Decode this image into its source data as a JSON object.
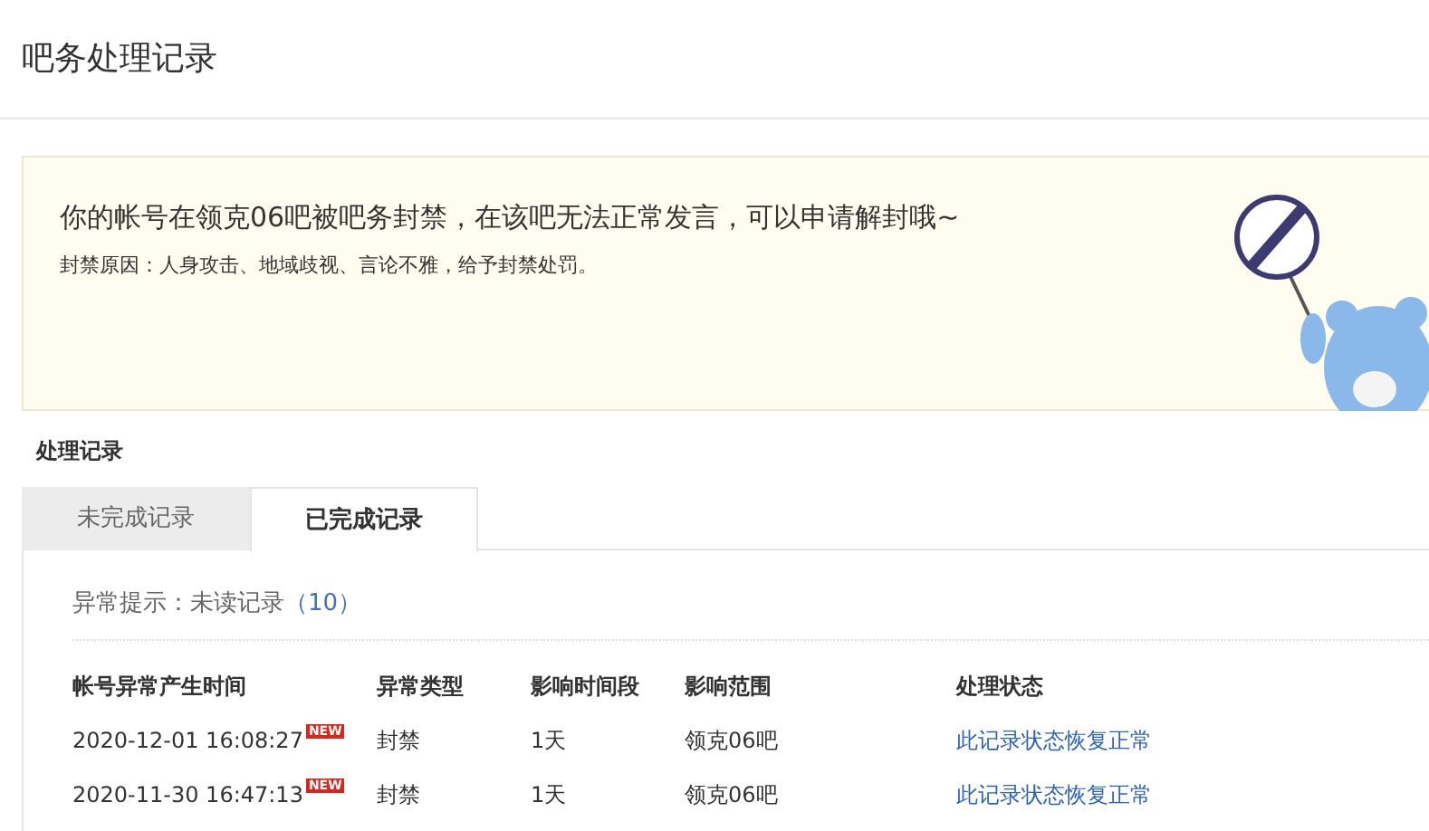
{
  "page_title": "吧务处理记录",
  "notice": {
    "message": "你的帐号在领克06吧被吧务封禁，在该吧无法正常发言，可以申请解封哦~",
    "reason": "封禁原因：人身攻击、地域歧视、言论不雅，给予封禁处罚。"
  },
  "section_title": "处理记录",
  "tabs": [
    {
      "label": "未完成记录",
      "selected": false
    },
    {
      "label": "已完成记录",
      "selected": true
    }
  ],
  "hint": {
    "label": "异常提示：未读记录",
    "count": "（10）"
  },
  "table": {
    "columns": [
      "帐号异常产生时间",
      "异常类型",
      "影响时间段",
      "影响范围",
      "处理状态"
    ],
    "rows": [
      {
        "time": "2020-12-01 16:08:27",
        "badge": "NEW",
        "type": "封禁",
        "duration": "1天",
        "scope": "领克06吧",
        "status": "此记录状态恢复正常"
      },
      {
        "time": "2020-11-30 16:47:13",
        "badge": "NEW",
        "type": "封禁",
        "duration": "1天",
        "scope": "领克06吧",
        "status": "此记录状态恢复正常"
      }
    ]
  }
}
